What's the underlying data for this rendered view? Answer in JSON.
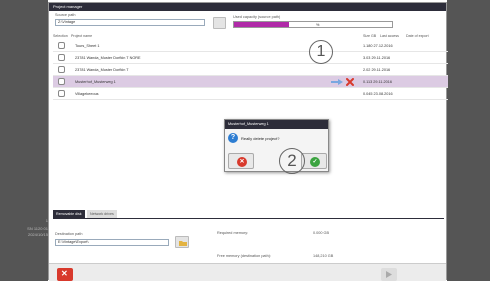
{
  "window": {
    "title": "Project manager"
  },
  "source": {
    "label": "Source path",
    "value": "Z:\\Vintage"
  },
  "capacity": {
    "label": "Used capacity (source path)",
    "percent_text": "%",
    "fill_fraction": 0.35,
    "bar_color": "#b02aa8"
  },
  "table": {
    "headers": {
      "selection": "Selection",
      "project_name": "Project name",
      "size": "Size GB",
      "last_access": "Last access",
      "date_of_export": "Date of export"
    },
    "rows": [
      {
        "name": "Tours_Sheet 1",
        "size_date": "1.180 27.12.2016",
        "selected": false
      },
      {
        "name": "23781 Wanda_Muster Dorfkin T NORE",
        "size_date": "3.03 29.11.2016",
        "selected": false
      },
      {
        "name": "23781 Wanda_Muster Dorfkin T",
        "size_date": "2.02 29.11.2016",
        "selected": false
      },
      {
        "name": "Musterhof_Musterweg 1",
        "size_date": "0.113 29.11.2016",
        "selected": true
      },
      {
        "name": "Villagekeeous",
        "size_date": "0.045 23.08.2016",
        "selected": false
      }
    ]
  },
  "callouts": {
    "one": "1",
    "two": "2"
  },
  "dialog": {
    "title": "Musterhof_Musterweg 1",
    "message": "Really delete project?",
    "question_glyph": "?"
  },
  "tabs": {
    "active": "Removable disk",
    "inactive": "Network drives"
  },
  "destination": {
    "label": "Destination path",
    "value": "E:\\Vintage\\Export\\"
  },
  "memory": {
    "required_label": "Required memory:",
    "required_value": "0.000 GB",
    "free_label": "Free memory (destination path):",
    "free_value": "148,210 GB"
  },
  "side": {
    "line1": "1",
    "line2": "SN 1120 01",
    "line3": "2024/10/15"
  },
  "colors": {
    "dark": "#2d2d3a",
    "selected_row": "#dccbe3",
    "cancel_red": "#d8392c",
    "ok_green": "#3aa33f",
    "info_blue": "#2d7dd2"
  },
  "icons": {
    "export": "arrow-right-icon",
    "delete": "red-x-icon",
    "cancel": "x-circle-icon",
    "confirm": "checkmark-circle-icon",
    "question": "question-icon",
    "folder": "folder-icon"
  }
}
